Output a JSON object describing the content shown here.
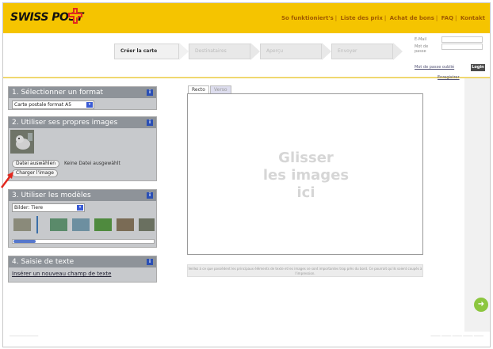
{
  "header": {
    "brand": "SWISS POST",
    "nav": [
      "So funktioniert's",
      "Liste des prix",
      "Achat de bons",
      "FAQ",
      "Kontakt"
    ]
  },
  "steps": [
    "Créer la carte",
    "Destinataires",
    "Aperçu",
    "Envoyer"
  ],
  "login": {
    "email_label": "E-Mail",
    "password_label": "Mot de passe",
    "forgot": "Mot de passe oublié",
    "login_button": "Login",
    "register": "Enregistrer"
  },
  "panels": {
    "format": {
      "title": "1. Sélectionner un format",
      "selected": "Carte postale format A5",
      "info": "i"
    },
    "images": {
      "title": "2. Utiliser ses propres images",
      "choose_file": "Datei auswählen",
      "no_file": "Keine Datei ausgewählt",
      "upload": "Charger l'image",
      "info": "i"
    },
    "models": {
      "title": "3. Utiliser les modèles",
      "selected": "Bilder: Tiere",
      "info": "i"
    },
    "text": {
      "title": "4. Saisie de texte",
      "link": "Insérer un nouveau champ de texte",
      "info": "i"
    }
  },
  "canvas": {
    "tabs": [
      "Recto",
      "Verso"
    ],
    "drop_lines": [
      "Glisser",
      "les images",
      "ici"
    ],
    "notice": "Veillez à ce que possèdent les principaux éléments de texte et les images se sont importantes trop près du bord. Ce pourrait qu'ils soient coupés à l'impression."
  },
  "colors": {
    "header": "#f5c400",
    "panel_head": "#8e9399",
    "accent_green": "#8cc63f",
    "cross_red": "#e2281e"
  }
}
